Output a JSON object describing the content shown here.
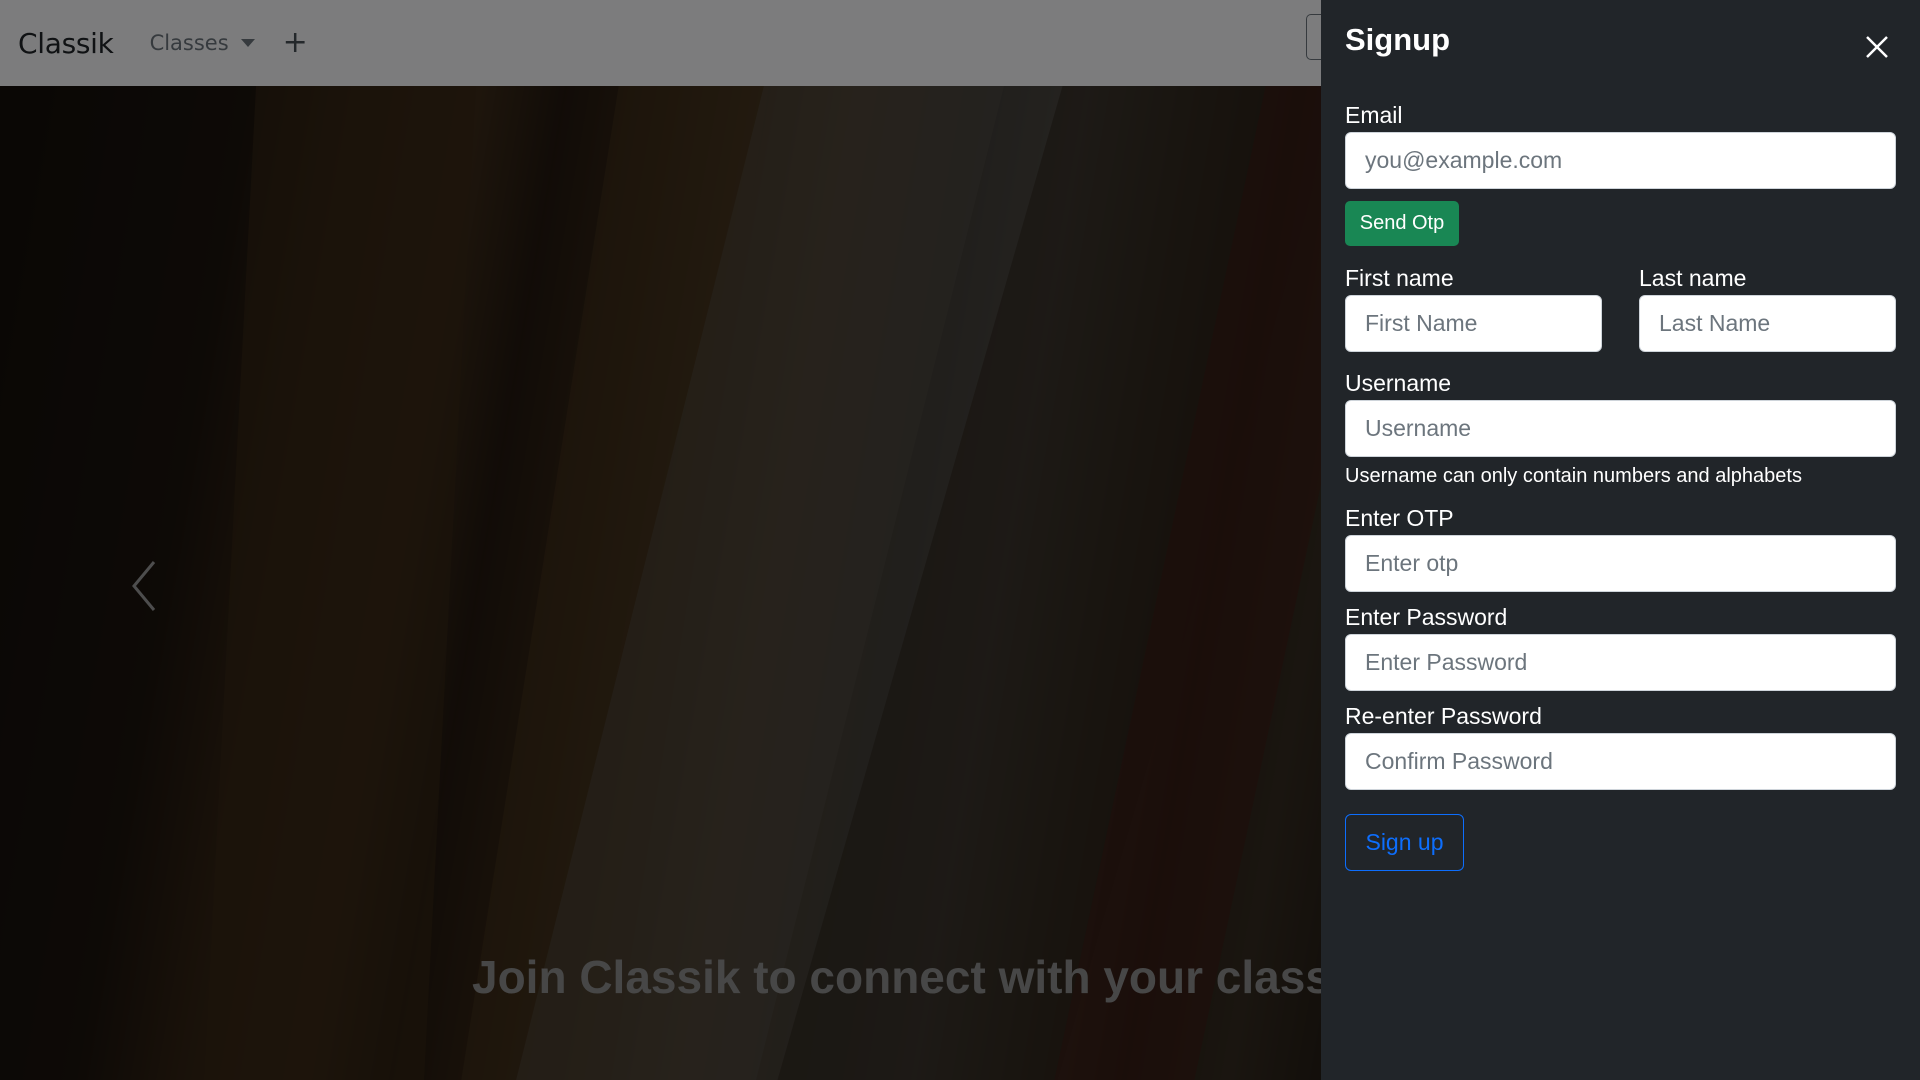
{
  "navbar": {
    "brand": "Classik",
    "classes_label": "Classes",
    "add_symbol": "+"
  },
  "hero": {
    "caption": "Join Classik to connect with your classn",
    "prev_icon": "chevron-left-icon"
  },
  "signup": {
    "title": "Signup",
    "close_icon": "close-icon",
    "email_label": "Email",
    "email_placeholder": "you@example.com",
    "send_otp_label": "Send Otp",
    "first_name_label": "First name",
    "first_name_placeholder": "First Name",
    "last_name_label": "Last name",
    "last_name_placeholder": "Last Name",
    "username_label": "Username",
    "username_placeholder": "Username",
    "username_help": "Username can only contain numbers and alphabets",
    "otp_label": "Enter OTP",
    "otp_placeholder": "Enter otp",
    "password_label": "Enter Password",
    "password_placeholder": "Enter Password",
    "confirm_label": "Re-enter Password",
    "confirm_placeholder": "Confirm Password",
    "signup_button": "Sign up"
  },
  "colors": {
    "panel_bg": "#212529",
    "success": "#198754",
    "primary": "#0d6efd",
    "navbar_bg": "#f8f9fa"
  }
}
